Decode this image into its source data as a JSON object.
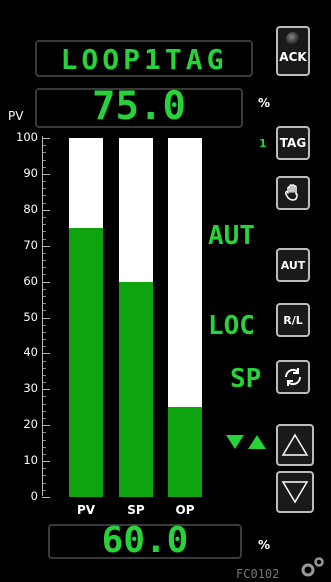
{
  "faceplate": {
    "tag": "LOOP1TAG",
    "pv_label": "PV",
    "pv_value": "75.0",
    "pv_unit": "%",
    "output_value": "60.0",
    "output_unit": "%",
    "footer_id": "FC0102"
  },
  "scale": {
    "ticks": [
      "100",
      "90",
      "80",
      "70",
      "60",
      "50",
      "40",
      "30",
      "20",
      "10",
      "0"
    ]
  },
  "bars": [
    {
      "label": "PV",
      "percent": 75
    },
    {
      "label": "SP",
      "percent": 60
    },
    {
      "label": "OP",
      "percent": 25
    }
  ],
  "buttons": {
    "ack": "ACK",
    "tag": "TAG",
    "tag_index": "1",
    "aut": "AUT",
    "rl": "R/L"
  },
  "status": {
    "mode": "AUT",
    "location": "LOC",
    "target": "SP"
  },
  "colors": {
    "green": "#28d23a",
    "bar_fill": "#0fa30f",
    "bar_bg": "#ffffff"
  },
  "icons": [
    "alarm-lamp-icon",
    "hand-icon",
    "refresh-icon",
    "triangle-up-icon",
    "triangle-down-icon",
    "gear-icon",
    "ramp-triangles-icon"
  ]
}
